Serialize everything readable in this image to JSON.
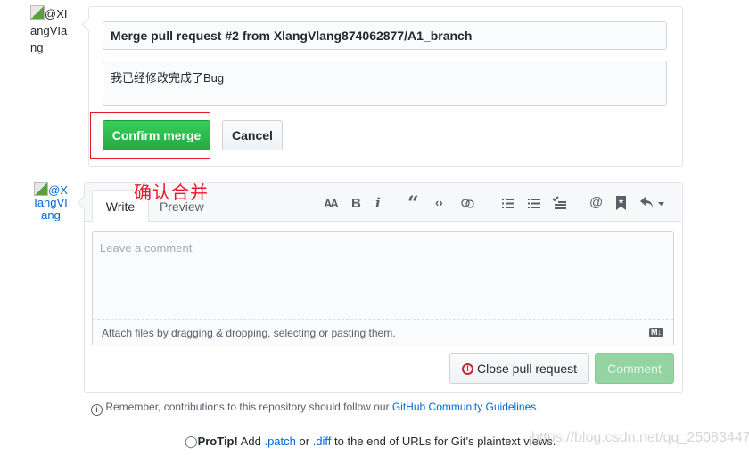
{
  "merge_form": {
    "author_avatar_alt": "@XIangVIang",
    "commit_title": "Merge pull request #2 from XlangVlang874062877/A1_branch",
    "commit_message": "我已经修改完成了Bug",
    "confirm_label": "Confirm merge",
    "cancel_label": "Cancel"
  },
  "annotation": {
    "text": "确认合并",
    "color": "#e8192c"
  },
  "comment_form": {
    "author_avatar_alt": "@XIangVIang",
    "tabs": [
      {
        "label": "Write",
        "active": true
      },
      {
        "label": "Preview",
        "active": false
      }
    ],
    "toolbar": [
      "text-size-icon",
      "bold-icon",
      "italic-icon",
      "quote-icon",
      "code-icon",
      "link-icon",
      "bullet-list-icon",
      "numbered-list-icon",
      "task-list-icon",
      "mention-icon",
      "bookmark-icon",
      "reply-icon"
    ],
    "toolbar_labels": {
      "text_size": "AA",
      "bold": "B",
      "italic": "i",
      "mention": "@"
    },
    "placeholder": "Leave a comment",
    "attach_hint": "Attach files by dragging & dropping, selecting or pasting them.",
    "markdown_badge": "M↓",
    "close_label": "Close pull request",
    "comment_label": "Comment"
  },
  "guidelines": {
    "text": "Remember, contributions to this repository should follow our ",
    "link": "GitHub Community Guidelines",
    "end": "."
  },
  "protip": {
    "lead": "ProTip!",
    "t1": " Add ",
    "patch": ".patch",
    "t2": " or ",
    "diff": ".diff",
    "t3": " to the end of URLs for Git’s plaintext views."
  },
  "watermark": "https://blog.csdn.net/qq_25083447",
  "colors": {
    "green": "#28a745",
    "link": "#0366d6",
    "danger": "#cb2431",
    "annotation": "#e8192c"
  }
}
